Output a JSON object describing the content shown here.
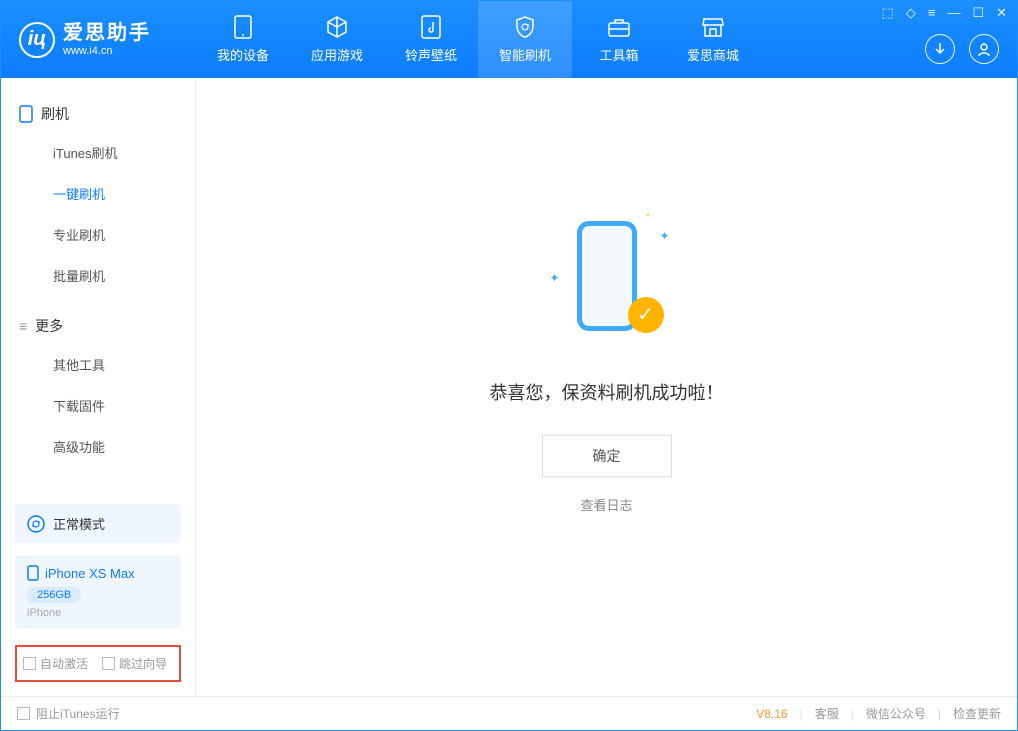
{
  "app": {
    "title": "爱思助手",
    "subtitle": "www.i4.cn"
  },
  "nav": {
    "tabs": [
      {
        "label": "我的设备"
      },
      {
        "label": "应用游戏"
      },
      {
        "label": "铃声壁纸"
      },
      {
        "label": "智能刷机"
      },
      {
        "label": "工具箱"
      },
      {
        "label": "爱思商城"
      }
    ]
  },
  "sidebar": {
    "group1_title": "刷机",
    "group1_items": [
      "iTunes刷机",
      "一键刷机",
      "专业刷机",
      "批量刷机"
    ],
    "group2_title": "更多",
    "group2_items": [
      "其他工具",
      "下载固件",
      "高级功能"
    ],
    "mode_label": "正常模式",
    "device": {
      "name": "iPhone XS Max",
      "capacity": "256GB",
      "type": "iPhone"
    },
    "checkbox1": "自动激活",
    "checkbox2": "跳过向导"
  },
  "main": {
    "success_message": "恭喜您，保资料刷机成功啦！",
    "ok_button": "确定",
    "view_log": "查看日志"
  },
  "footer": {
    "block_itunes": "阻止iTunes运行",
    "version": "V8.16",
    "links": [
      "客服",
      "微信公众号",
      "检查更新"
    ]
  }
}
